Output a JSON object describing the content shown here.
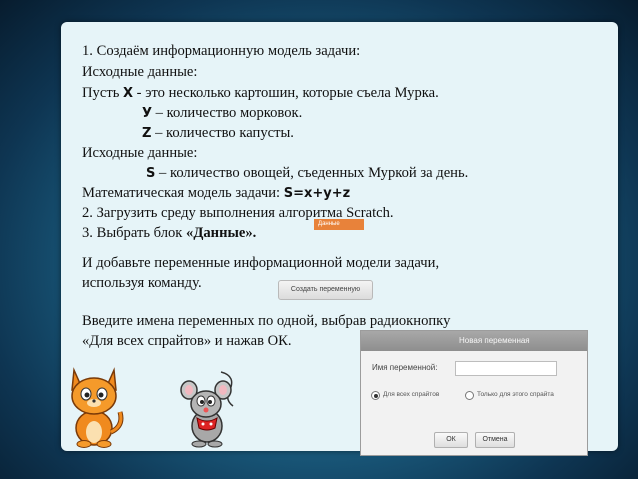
{
  "slide": {
    "line1": "1.  Создаём информационную модель задачи:",
    "line2": "Исходные данные:",
    "line3_prefix": "Пусть ",
    "line3_var": "X",
    "line3_rest": "   - это несколько картошин, которые съела Мурка.",
    "line4_var": "У",
    "line4_rest": " – количество морковок.",
    "line5_var": "Z",
    "line5_rest": " – количество капусты.",
    "line6": "Исходные данные:",
    "line7_var": "S",
    "line7_rest": " – количество овощей, съеденных Муркой за день.",
    "line8_prefix": "Математическая модель задачи: ",
    "line8_formula": "S=x+y+z",
    "line9": "2. Загрузить среду выполнения алгоритма Scratch.",
    "line10_prefix": "3. Выбрать блок ",
    "line10_bold": "«Данные».",
    "line11": "И добавьте переменные информационной модели задачи,",
    "line12": "используя команду.",
    "line13": "Введите имена переменных по одной, выбрав радиокнопку",
    "line14": "«Для всех спрайтов» и нажав ОК."
  },
  "scratch": {
    "data_block_label": "Данные",
    "create_variable_button": "Создать переменную"
  },
  "dialog": {
    "title": "Новая переменная",
    "name_label": "Имя переменной:",
    "name_value": "",
    "radio_all": "Для всех спрайтов",
    "radio_this": "Только для этого спрайта",
    "ok": "ОК",
    "cancel": "Отмена"
  },
  "colors": {
    "background": "#1b5f82",
    "panel": "#e6f4f8",
    "data_block": "#e8823a"
  }
}
